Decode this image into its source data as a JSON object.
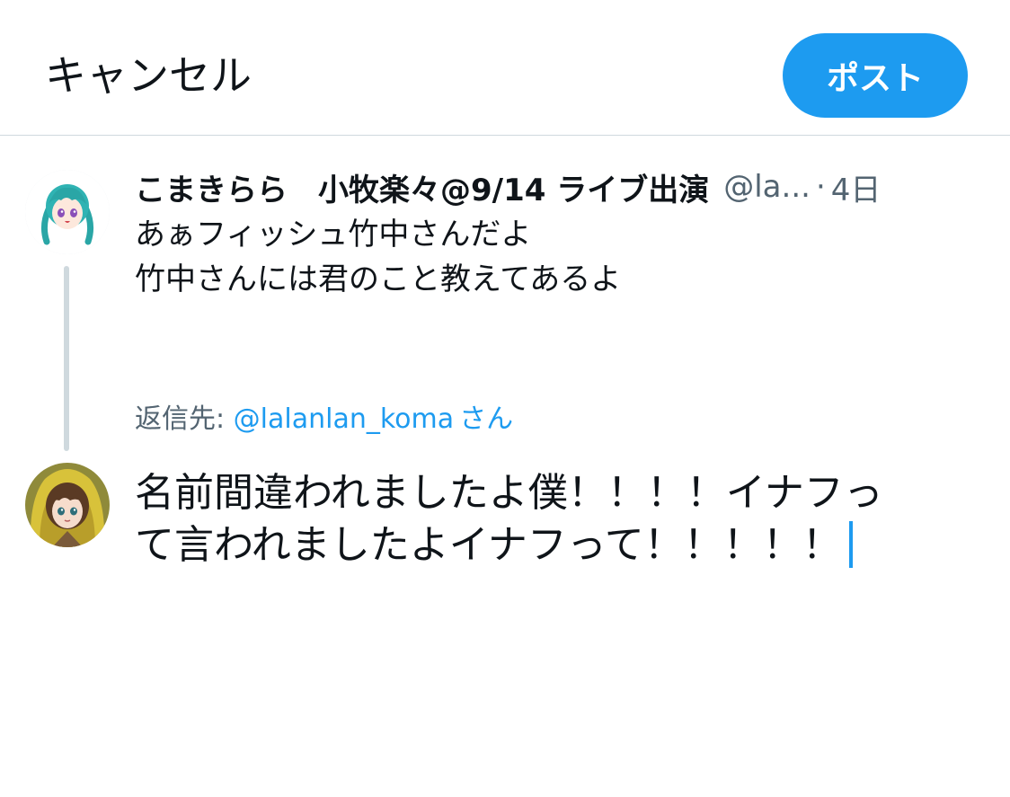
{
  "topbar": {
    "cancel_label": "キャンセル",
    "post_label": "ポスト"
  },
  "colors": {
    "accent": "#1d9bf0",
    "secondary_text": "#536471",
    "divider": "#cfd9de"
  },
  "original_tweet": {
    "display_name": "こまきらら　小牧楽々@9/14 ライブ出演",
    "handle": "@la...",
    "separator": "·",
    "time": "4日",
    "lines": [
      "あぁフィッシュ竹中さんだよ",
      "竹中さんには君のこと教えてあるよ"
    ]
  },
  "reply": {
    "label": "返信先:",
    "mention": "@lalanlan_koma",
    "suffix": "さん"
  },
  "compose": {
    "lines": [
      "名前間違われましたよ僕！！！！イナフっ",
      "て言われましたよイナフって！！！！！"
    ]
  },
  "icons": {
    "original_avatar": "avatar-anime-girl-teal-hair",
    "user_avatar": "avatar-anime-girl-yellow-raincoat"
  }
}
